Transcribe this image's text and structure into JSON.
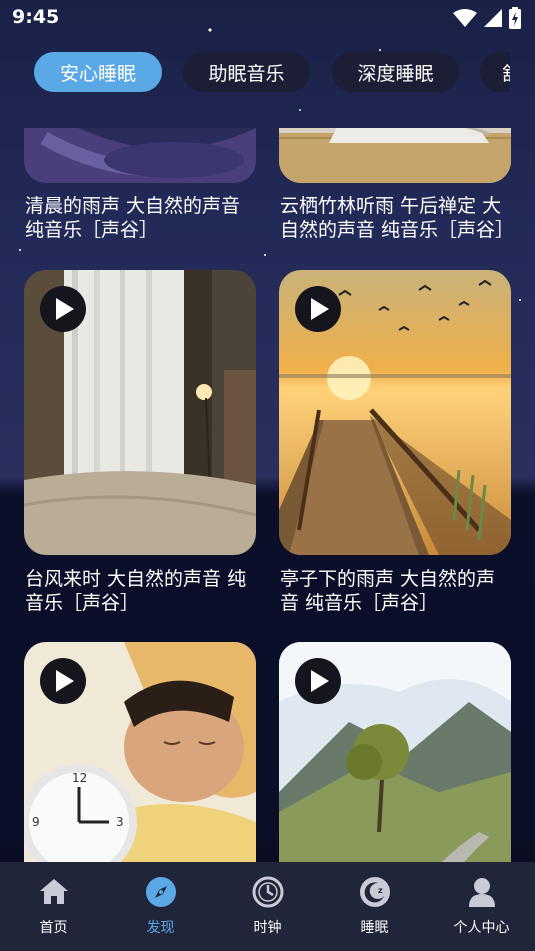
{
  "status_bar": {
    "time": "9:45"
  },
  "tabs": [
    {
      "label": "安心睡眠",
      "active": true
    },
    {
      "label": "助眠音乐",
      "active": false
    },
    {
      "label": "深度睡眠",
      "active": false
    },
    {
      "label": "舒",
      "active": false
    }
  ],
  "cards": [
    {
      "title": "清晨的雨声 大自然的声音 纯音乐［声谷］",
      "image": "night-rain-scene"
    },
    {
      "title": "云栖竹林听雨 午后禅定 大自然的声音 纯音乐［声谷］",
      "image": "bamboo-mat-scene"
    },
    {
      "title": "台风来时 大自然的声音 纯音乐［声谷］",
      "image": "bedroom-window-scene"
    },
    {
      "title": "亭子下的雨声 大自然的声音 纯音乐［声谷］",
      "image": "sunset-pier-scene"
    },
    {
      "title": "",
      "image": "sleeping-man-clock-scene"
    },
    {
      "title": "",
      "image": "mountain-tree-road-scene"
    }
  ],
  "bottom_nav": [
    {
      "label": "首页",
      "icon": "home-icon",
      "active": false
    },
    {
      "label": "发现",
      "icon": "compass-icon",
      "active": true
    },
    {
      "label": "时钟",
      "icon": "clock-icon",
      "active": false
    },
    {
      "label": "睡眠",
      "icon": "moon-icon",
      "active": false
    },
    {
      "label": "个人中心",
      "icon": "person-icon",
      "active": false
    }
  ],
  "colors": {
    "accent": "#5aa8e6",
    "nav_bg": "#20253a",
    "tab_bg": "#1b1e35"
  }
}
